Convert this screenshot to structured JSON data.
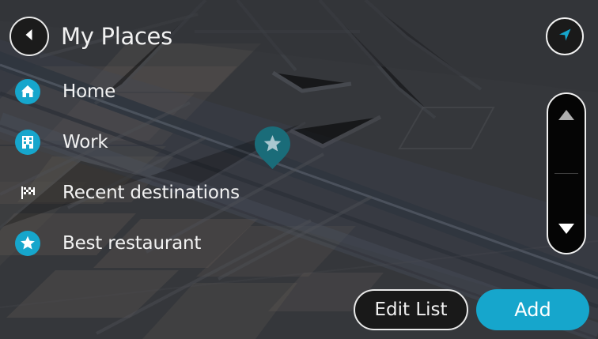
{
  "header": {
    "title": "My Places",
    "back_icon": "back-arrow-icon"
  },
  "places": [
    {
      "label": "Home",
      "icon": "home-icon"
    },
    {
      "label": "Work",
      "icon": "building-icon"
    },
    {
      "label": "Recent destinations",
      "icon": "checkered-flag-icon"
    },
    {
      "label": "Best restaurant",
      "icon": "star-icon"
    }
  ],
  "map": {
    "marker_icon": "star-icon"
  },
  "controls": {
    "location_icon": "navigation-arrow-icon",
    "scroll_up_icon": "chevron-up-icon",
    "scroll_down_icon": "chevron-down-icon"
  },
  "footer": {
    "edit_label": "Edit List",
    "add_label": "Add"
  },
  "colors": {
    "accent": "#16a6cc",
    "pin": "#1a6c79",
    "map_background": "#333539",
    "map_blocks": "#615c59",
    "water": "#3f4b5c"
  }
}
